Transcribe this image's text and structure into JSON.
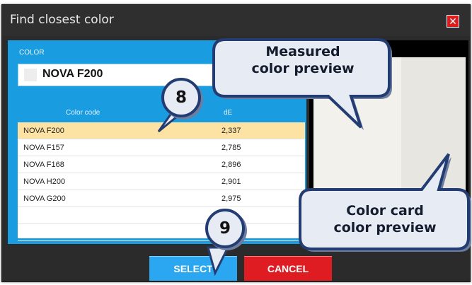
{
  "dialog": {
    "title": "Find closest color",
    "close_symbol": "✕",
    "color_label": "COLOR",
    "color_value": "NOVA F200",
    "columns": {
      "code": "Color code",
      "de": "dE"
    },
    "rows": [
      {
        "code": "NOVA F200",
        "de": "2,337",
        "selected": true
      },
      {
        "code": "NOVA F157",
        "de": "2,785"
      },
      {
        "code": "NOVA F168",
        "de": "2,896"
      },
      {
        "code": "NOVA H200",
        "de": "2,901"
      },
      {
        "code": "NOVA G200",
        "de": "2,975"
      }
    ],
    "select_label": "SELECT",
    "cancel_label": "CANCEL"
  },
  "annotations": {
    "measured_preview": "Measured color preview",
    "card_preview": "Color card color preview",
    "badge_8": "8",
    "badge_9": "9"
  },
  "colors": {
    "panel_blue": "#1a9de0",
    "selected_row": "#fde3a3",
    "select_button": "#2aa7f0",
    "cancel_button": "#e01c23",
    "callout_fill": "#e6ebf4",
    "callout_border": "#233c72"
  }
}
